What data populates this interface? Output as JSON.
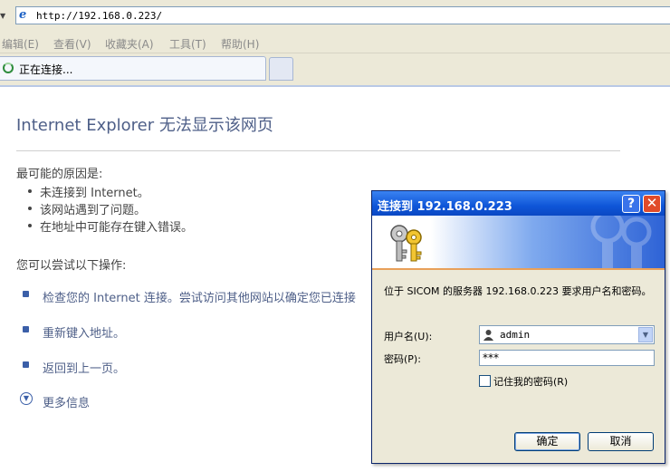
{
  "address_bar": {
    "url": "http://192.168.0.223/"
  },
  "menu": [
    {
      "label": "编辑(E)"
    },
    {
      "label": "查看(V)"
    },
    {
      "label": "收藏夹(A)"
    },
    {
      "label": "工具(T)"
    },
    {
      "label": "帮助(H)"
    }
  ],
  "tab": {
    "label": "正在连接..."
  },
  "page": {
    "title": "Internet Explorer 无法显示该网页",
    "causes_heading": "最可能的原因是:",
    "causes": [
      "未连接到 Internet。",
      "该网站遇到了问题。",
      "在地址中可能存在键入错误。"
    ],
    "try_heading": "您可以尝试以下操作:",
    "actions": [
      "检查您的 Internet 连接。尝试访问其他网站以确定您已连接",
      "重新键入地址。",
      "返回到上一页。"
    ],
    "more_info": "更多信息"
  },
  "dialog": {
    "title": "连接到 192.168.0.223",
    "help_glyph": "?",
    "close_glyph": "✕",
    "message": "位于 SICOM 的服务器 192.168.0.223 要求用户名和密码。",
    "username_label": "用户名(U):",
    "username_value": "admin",
    "password_label": "密码(P):",
    "password_value": "***",
    "remember_label": "记住我的密码(R)",
    "remember_checked": false,
    "ok_label": "确定",
    "cancel_label": "取消"
  },
  "colors": {
    "title_bar": "#0f56d8",
    "link": "#4e5f88",
    "close": "#e14b2a"
  }
}
